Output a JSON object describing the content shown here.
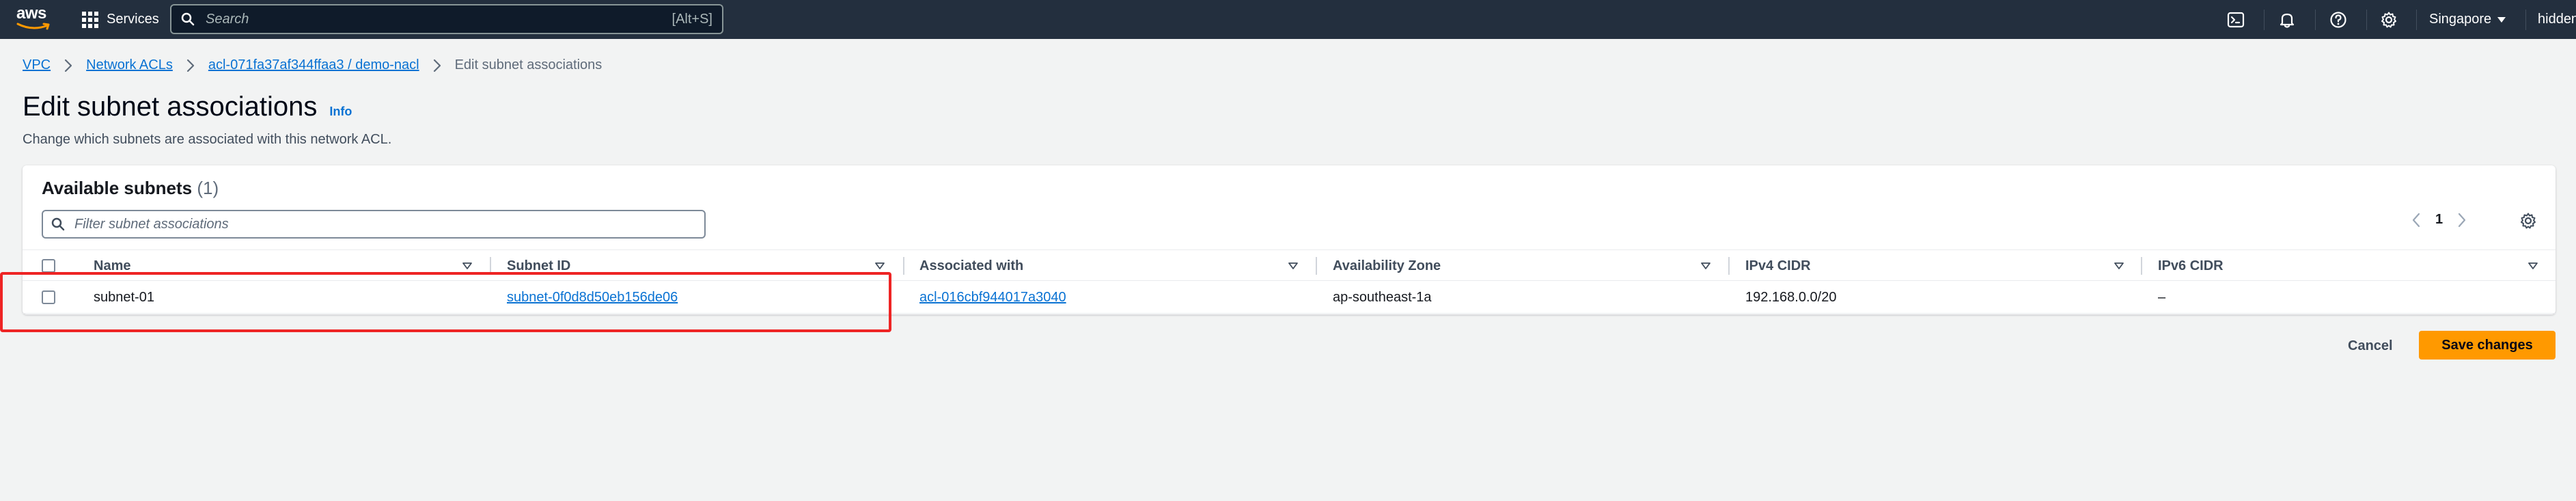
{
  "topnav": {
    "logo_text": "aws",
    "services_label": "Services",
    "search_placeholder": "Search",
    "search_shortcut": "[Alt+S]",
    "region_label": "Singapore",
    "user_label": "hidden"
  },
  "breadcrumb": {
    "items": [
      {
        "label": "VPC"
      },
      {
        "label": "Network ACLs"
      },
      {
        "label": "acl-071fa37af344ffaa3 / demo-nacl"
      }
    ],
    "current": "Edit subnet associations"
  },
  "header": {
    "title": "Edit subnet associations",
    "info_label": "Info",
    "description": "Change which subnets are associated with this network ACL."
  },
  "subnets_panel": {
    "title": "Available subnets",
    "count": "(1)",
    "filter_placeholder": "Filter subnet associations",
    "page_number": "1",
    "columns": [
      "Name",
      "Subnet ID",
      "Associated with",
      "Availability Zone",
      "IPv4 CIDR",
      "IPv6 CIDR"
    ],
    "rows": [
      {
        "name": "subnet-01",
        "subnet_id": "subnet-0f0d8d50eb156de06",
        "associated_with": "acl-016cbf944017a3040",
        "availability_zone": "ap-southeast-1a",
        "ipv4_cidr": "192.168.0.0/20",
        "ipv6_cidr": "–",
        "selected": false
      }
    ]
  },
  "footer": {
    "cancel_label": "Cancel",
    "save_label": "Save changes"
  },
  "colors": {
    "nav_bg": "#232f3e",
    "link": "#0972d3",
    "primary_button": "#ff9900",
    "highlight": "#ee2424",
    "page_bg": "#f2f3f3"
  }
}
